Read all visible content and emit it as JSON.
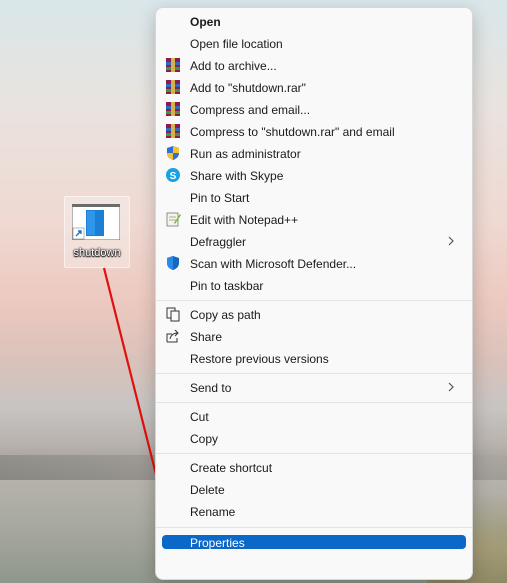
{
  "desktop": {
    "icon_label": "shutdown"
  },
  "menu": {
    "group1": [
      "Open",
      "Open file location",
      "Add to archive...",
      "Add to \"shutdown.rar\"",
      "Compress and email...",
      "Compress to \"shutdown.rar\" and email",
      "Run as administrator",
      "Share with Skype",
      "Pin to Start",
      "Edit with Notepad++",
      "Defraggler",
      "Scan with Microsoft Defender...",
      "Pin to taskbar"
    ],
    "group2": [
      "Copy as path",
      "Share",
      "Restore previous versions"
    ],
    "group3": [
      "Send to"
    ],
    "group4": [
      "Cut",
      "Copy"
    ],
    "group5": [
      "Create shortcut",
      "Delete",
      "Rename"
    ],
    "group6": [
      "Properties"
    ]
  },
  "icons": {
    "winrar": "winrar-icon",
    "shield": "uac-shield-icon",
    "skype": "skype-icon",
    "notepad": "notepad-plus-plus-icon",
    "defender": "defender-shield-icon",
    "share": "share-icon",
    "copy": "copy-path-icon"
  },
  "colors": {
    "highlight": "#0b67c8",
    "arrow": "#e01010"
  }
}
